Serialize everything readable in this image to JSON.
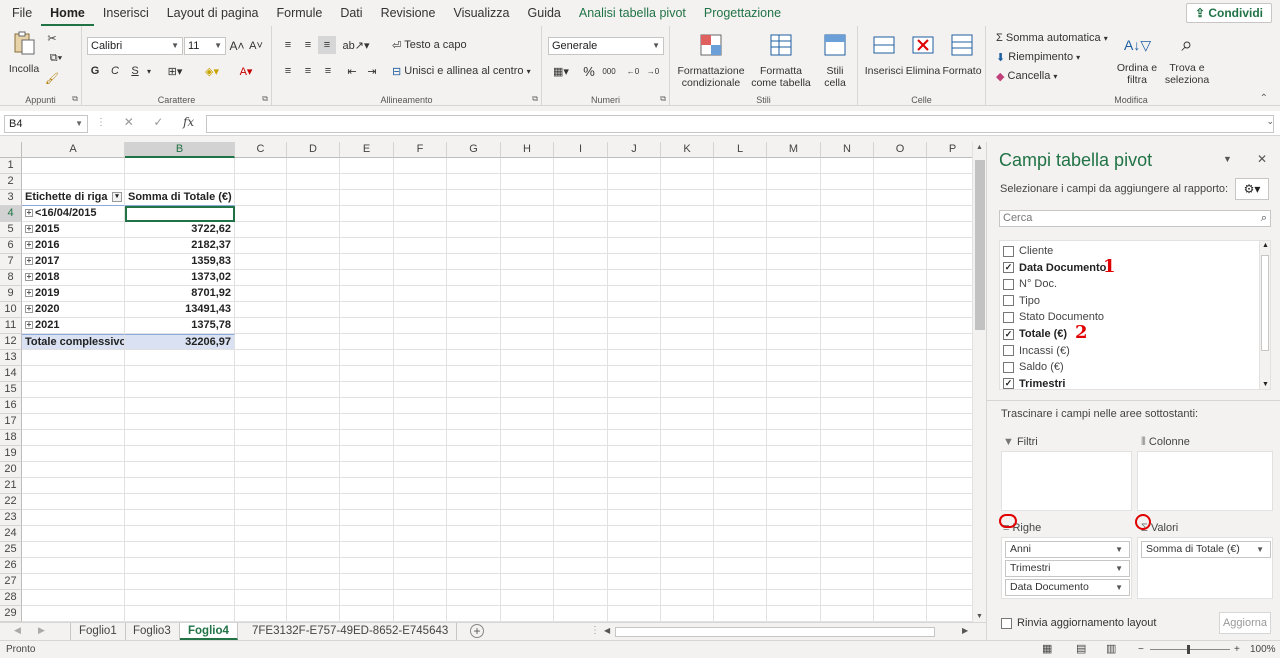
{
  "ribbon_tabs": [
    "File",
    "Home",
    "Inserisci",
    "Layout di pagina",
    "Formule",
    "Dati",
    "Revisione",
    "Visualizza",
    "Guida",
    "Analisi tabella pivot",
    "Progettazione"
  ],
  "share_label": "Condividi",
  "clipboard": {
    "paste": "Incolla",
    "group": "Appunti"
  },
  "font": {
    "name": "Calibri",
    "size": "11",
    "bold": "G",
    "italic": "C",
    "underline": "S",
    "group": "Carattere"
  },
  "alignment": {
    "wrap": "Testo a capo",
    "merge": "Unisci e allinea al centro",
    "group": "Allineamento"
  },
  "number": {
    "format": "Generale",
    "group": "Numeri"
  },
  "styles": {
    "conditional": "Formattazione condizionale",
    "table": "Formatta come tabella",
    "cell": "Stili cella",
    "group": "Stili"
  },
  "cells": {
    "insert": "Inserisci",
    "delete": "Elimina",
    "format": "Formato",
    "group": "Celle"
  },
  "editing": {
    "autosum": "Somma automatica",
    "fill": "Riempimento",
    "clear": "Cancella",
    "sort": "Ordina e filtra",
    "find": "Trova e seleziona",
    "group": "Modifica"
  },
  "name_box": "B4",
  "columns": [
    "A",
    "B",
    "C",
    "D",
    "E",
    "F",
    "G",
    "H",
    "I",
    "J",
    "K",
    "L",
    "M",
    "N",
    "O",
    "P"
  ],
  "rows": [
    "1",
    "2",
    "3",
    "4",
    "5",
    "6",
    "7",
    "8",
    "9",
    "10",
    "11",
    "12",
    "13",
    "14",
    "15",
    "16",
    "17",
    "18",
    "19",
    "20",
    "21",
    "22",
    "23",
    "24",
    "25",
    "26",
    "27",
    "28",
    "29"
  ],
  "pivot": {
    "header_row_label": "Etichette di riga",
    "header_value": "Somma di Totale (€)",
    "rows": [
      {
        "label": "<16/04/2015",
        "value": ""
      },
      {
        "label": "2015",
        "value": "3722,62"
      },
      {
        "label": "2016",
        "value": "2182,37"
      },
      {
        "label": "2017",
        "value": "1359,83"
      },
      {
        "label": "2018",
        "value": "1373,02"
      },
      {
        "label": "2019",
        "value": "8701,92"
      },
      {
        "label": "2020",
        "value": "13491,43"
      },
      {
        "label": "2021",
        "value": "1375,78"
      }
    ],
    "total_label": "Totale complessivo",
    "total_value": "32206,97"
  },
  "sheets": [
    "Foglio1",
    "Foglio3",
    "Foglio4",
    "7FE3132F-E757-49ED-8652-E745643"
  ],
  "status": "Pronto",
  "zoom": "100%",
  "pane": {
    "title": "Campi tabella pivot",
    "subtitle": "Selezionare i campi da aggiungere al rapporto:",
    "search_placeholder": "Cerca",
    "fields": [
      {
        "name": "Cliente",
        "checked": false
      },
      {
        "name": "Data Documento",
        "checked": true
      },
      {
        "name": "N° Doc.",
        "checked": false
      },
      {
        "name": "Tipo",
        "checked": false
      },
      {
        "name": "Stato Documento",
        "checked": false
      },
      {
        "name": "Totale (€)",
        "checked": true
      },
      {
        "name": "Incassi (€)",
        "checked": false
      },
      {
        "name": "Saldo (€)",
        "checked": false
      },
      {
        "name": "Trimestri",
        "checked": true
      }
    ],
    "drag_hint": "Trascinare i campi nelle aree sottostanti:",
    "filters_label": "Filtri",
    "columns_label": "Colonne",
    "rows_label": "Righe",
    "values_label": "Valori",
    "rows_items": [
      "Anni",
      "Trimestri",
      "Data Documento"
    ],
    "values_items": [
      "Somma di Totale (€)"
    ],
    "defer_label": "Rinvia aggiornamento layout",
    "update_label": "Aggiorna"
  },
  "annotations": [
    "1",
    "2"
  ]
}
